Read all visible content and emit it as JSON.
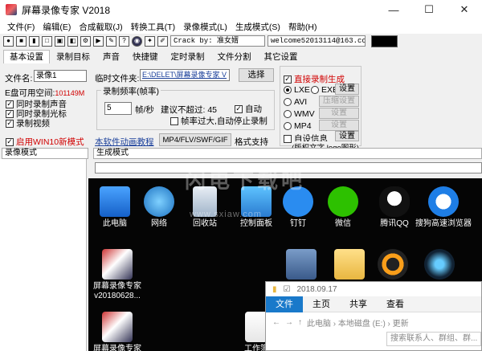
{
  "window": {
    "title": "屏幕录像专家 V2018",
    "minimize": "—",
    "maximize": "☐",
    "close": "✕"
  },
  "menu": [
    "文件(F)",
    "编辑(E)",
    "合成截取(J)",
    "转换工具(T)",
    "录像模式(L)",
    "生成模式(S)",
    "帮助(H)"
  ],
  "toolbar": {
    "crack": "Crack by: 准女婿",
    "welcome": "welcome52013114@163.com"
  },
  "tabs": [
    "基本设置",
    "录制目标",
    "声音",
    "快捷键",
    "定时录制",
    "文件分割",
    "其它设置"
  ],
  "basic": {
    "filename_label": "文件名:",
    "filename_value": "录像1",
    "temp_label": "临时文件夹:",
    "temp_value": "E:\\DELET\\屏幕录像专家 V",
    "choose_button": "选择",
    "disk_label": "E盘可用空间:",
    "disk_value": "101149M",
    "rec_sound": "同时录制声音",
    "rec_cursor": "同时录制光标",
    "rec_video": "录制视频",
    "win10_mode": "启用WIN10新模式",
    "freq_group": "录制频率(帧率)",
    "fps_value": "5",
    "fps_unit": "帧/秒",
    "max_label": "建议不超过: 45",
    "auto": "自动",
    "frame_over": "帧率过大,自动停止录制",
    "tutorial_link": "本软件动画教程",
    "format_button": "MP4/FLV/SWF/GIF",
    "format_support": "格式支持"
  },
  "generate": {
    "direct": "直接录制生成",
    "lxe": "LXE",
    "exe": "EXE",
    "settings": "设置",
    "avi": "AVI",
    "compress": "压缩设置",
    "wmv": "WMV",
    "wmv_settings": "设置",
    "mp4": "MP4",
    "mp4_settings": "设置",
    "custom_info": "自设信息",
    "custom_settings": "设置",
    "copyright": "(版权文字 logo图形)"
  },
  "status": {
    "rec_mode": "录像模式",
    "gen_mode": "生成模式"
  },
  "desktop": {
    "icons": [
      "此电脑",
      "网络",
      "回收站",
      "控制面板",
      "钉钉",
      "微信",
      "腾讯QQ",
      "搜狗高速浏览器",
      "屏幕录像专家 v20180628...",
      "屏幕录像专家",
      "工作簿"
    ],
    "explorer": {
      "date": "2018.09.17",
      "tabs": [
        "文件",
        "主页",
        "共享",
        "查看"
      ],
      "path": "此电脑 › 本地磁盘 (E:) › 更新",
      "search": "搜索联系人、群组、群..."
    },
    "watermark": "闪电下载吧",
    "watermark_url": "www.sxiaw.com"
  }
}
